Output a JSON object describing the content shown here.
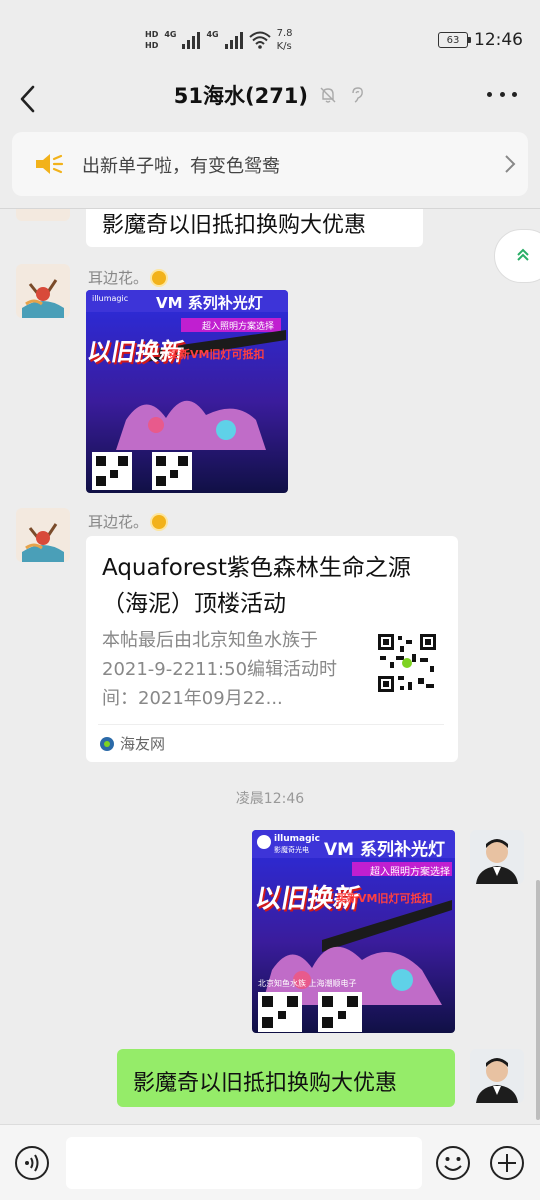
{
  "statusbar": {
    "hd1": "HD",
    "hd2": "HD",
    "net1": "4G",
    "net2": "4G",
    "speed_value": "7.8",
    "speed_unit": "K/s",
    "battery": "63",
    "time": "12:46"
  },
  "header": {
    "title": "51海水(271)"
  },
  "notice": {
    "text": "出新单子啦，有变色鸳鸯"
  },
  "messages": {
    "m1_text": "影魔奇以旧抵扣换购大优惠",
    "sender_name": "耳边花。",
    "card": {
      "title": "Aquaforest紫色森林生命之源（海泥）顶楼活动",
      "desc": "本帖最后由北京知鱼水族于2021-9-2211:50编辑活动时间：2021年09月22...",
      "source": "海友网"
    },
    "timestamp": "凌晨12:46",
    "my_text": "影魔奇以旧抵扣换购大优惠"
  },
  "poster": {
    "brand": "illumagic",
    "brand_sub": "影魔奇光电",
    "headline": "VM 系列补光灯",
    "banner": "超入照明方案选择",
    "swap": "以旧换新",
    "offer": "买新VM旧灯可抵扣",
    "stores": "北京知鱼水族  上海潮顺电子"
  },
  "colors": {
    "bubble_green": "#95ec69",
    "background": "#ededed",
    "accent_yellow": "#f2b21a"
  }
}
